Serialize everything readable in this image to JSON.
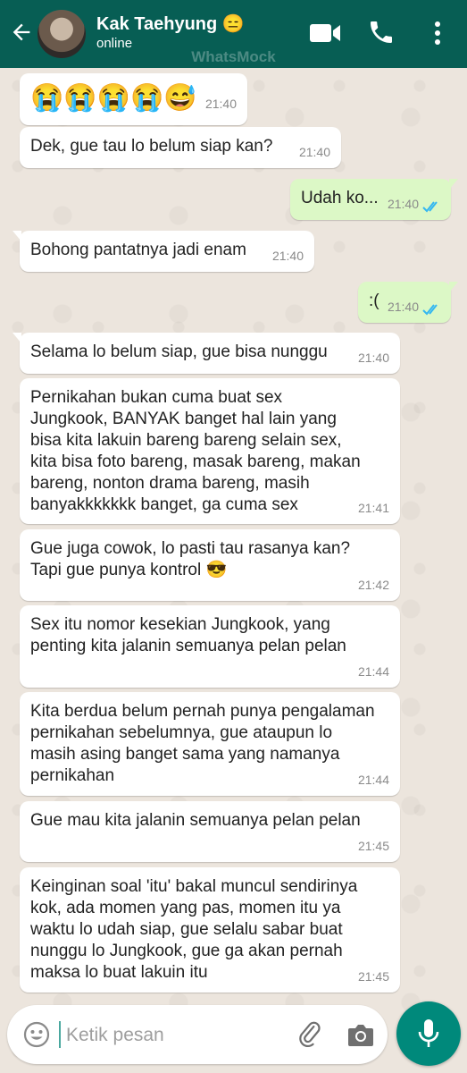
{
  "header": {
    "contact_name": "Kak Taehyung 😑",
    "status": "online",
    "watermark": "WhatsMock"
  },
  "input": {
    "placeholder": "Ketik pesan"
  },
  "messages": [
    {
      "direction": "in",
      "text": "😭😭😭😭😅",
      "time": "21:40"
    },
    {
      "direction": "in",
      "text": "Dek, gue tau lo belum siap kan?",
      "time": "21:40"
    },
    {
      "direction": "out",
      "text": "Udah ko...",
      "time": "21:40",
      "read": true
    },
    {
      "direction": "in",
      "text": "Bohong pantatnya jadi enam",
      "time": "21:40"
    },
    {
      "direction": "out",
      "text": ":(",
      "time": "21:40",
      "read": true
    },
    {
      "direction": "in",
      "text": "Selama lo belum siap, gue bisa nunggu",
      "time": "21:40"
    },
    {
      "direction": "in",
      "text": "Pernikahan bukan cuma buat sex Jungkook, BANYAK banget hal lain yang bisa kita lakuin bareng bareng selain sex, kita bisa foto bareng, masak bareng, makan bareng, nonton drama bareng, masih banyakkkkkkk banget, ga cuma sex",
      "time": "21:41"
    },
    {
      "direction": "in",
      "text": "Gue juga cowok, lo pasti tau rasanya kan? Tapi gue punya kontrol 😎",
      "time": "21:42"
    },
    {
      "direction": "in",
      "text": "Sex itu nomor kesekian Jungkook, yang penting kita jalanin semuanya pelan pelan",
      "time": "21:44"
    },
    {
      "direction": "in",
      "text": "Kita berdua belum pernah punya pengalaman pernikahan sebelumnya, gue ataupun lo masih asing banget sama yang namanya pernikahan",
      "time": "21:44"
    },
    {
      "direction": "in",
      "text": "Gue mau kita jalanin semuanya pelan pelan",
      "time": "21:45"
    },
    {
      "direction": "in",
      "text": "Keinginan soal 'itu' bakal muncul sendirinya kok, ada momen yang pas, momen itu ya waktu lo udah siap, gue selalu sabar buat nunggu lo Jungkook, gue ga akan pernah maksa lo buat lakuin itu",
      "time": "21:45"
    }
  ]
}
